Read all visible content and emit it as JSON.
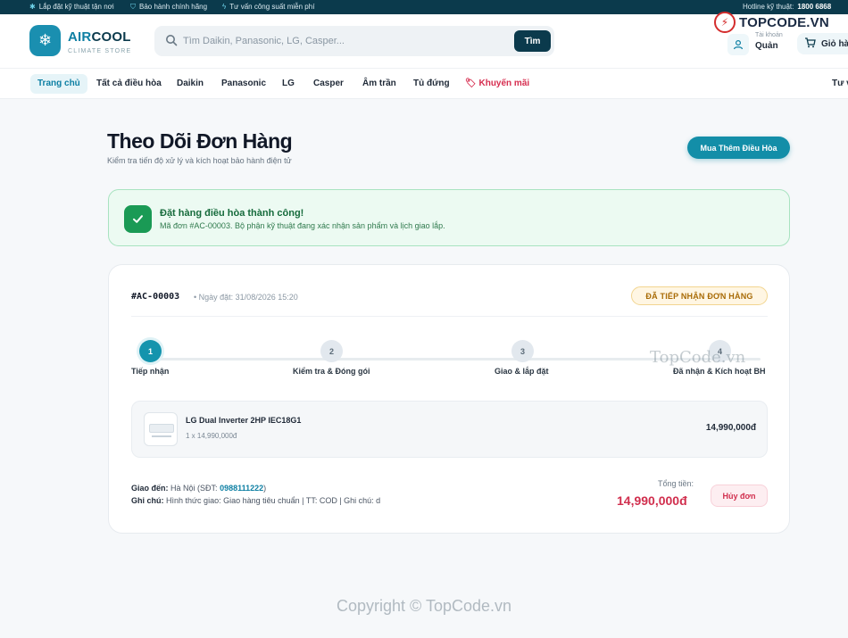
{
  "topbar": {
    "items": [
      {
        "icon": "wrench-icon",
        "text": "Lắp đặt kỹ thuật tận nơi"
      },
      {
        "icon": "shield-icon",
        "text": "Bảo hành chính hãng"
      },
      {
        "icon": "bolt-icon",
        "text": "Tư vấn công suất miễn phí"
      }
    ],
    "hotline_label": "Hotline kỹ thuật:",
    "hotline_number": "1800 6868"
  },
  "brand": {
    "name_part1": "AIR",
    "name_part2": "COOL",
    "tagline": "CLIMATE STORE",
    "logo_icon": "snowflake-icon"
  },
  "search": {
    "placeholder": "Tìm Daikin, Panasonic, LG, Casper...",
    "value": "",
    "button_label": "Tìm"
  },
  "partner_badge": {
    "text": "TOPCODE.VN"
  },
  "account": {
    "caption": "Tài khoản",
    "name": "Quản"
  },
  "cart": {
    "label": "Giỏ hàng"
  },
  "nav": {
    "items": [
      {
        "label": "Trang chủ",
        "active": true
      },
      {
        "label": "Tất cả điều hòa"
      },
      {
        "label": "Daikin"
      },
      {
        "label": "Panasonic"
      },
      {
        "label": "LG"
      },
      {
        "label": "Casper"
      },
      {
        "label": "Âm trần"
      },
      {
        "label": "Tủ đứng"
      },
      {
        "label": "Khuyến mãi",
        "icon": "tag-icon"
      }
    ],
    "right_label": "Tư vấn"
  },
  "page": {
    "title": "Theo Dõi Đơn Hàng",
    "subtitle": "Kiểm tra tiến độ xử lý và kích hoạt bảo hành điện tử",
    "buy_more_label": "Mua Thêm Điều Hòa"
  },
  "alert": {
    "title": "Đặt hàng điều hòa thành công!",
    "message": "Mã đơn #AC-00003. Bộ phận kỹ thuật đang xác nhận sản phẩm và lịch giao lắp.",
    "color": "#1a9a55"
  },
  "order": {
    "id": "#AC-00003",
    "date": "• Ngày đặt: 31/08/2026 15:20",
    "status": "ĐÃ TIẾP NHẬN ĐƠN HÀNG",
    "steps": [
      {
        "number": "1",
        "label": "Tiếp nhận",
        "done": true
      },
      {
        "number": "2",
        "label": "Kiểm tra & Đóng gói",
        "done": false
      },
      {
        "number": "3",
        "label": "Giao & lắp đặt",
        "done": false
      },
      {
        "number": "4",
        "label": "Đã nhận & Kích hoạt BH",
        "done": false
      }
    ],
    "item": {
      "name": "LG Dual Inverter 2HP IEC18G1",
      "qty": "1 x 14,990,000đ",
      "price": "14,990,000đ"
    },
    "ship_label": "Giao đến:",
    "ship_address": "Hà Nội (SĐT:",
    "ship_phone": "0988111222",
    "ship_close": ")",
    "note_label": "Ghi chú:",
    "note_text": "Hình thức giao: Giao hàng tiêu chuẩn | TT: COD | Ghi chú: d",
    "total_label": "Tổng tiền:",
    "total_value": "14,990,000đ",
    "cancel_label": "Hủy đơn"
  },
  "watermarks": {
    "mid": "TopCode.vn",
    "footer": "Copyright © TopCode.vn"
  },
  "colors": {
    "accent": "#138ea8",
    "dark": "#0b3a4c",
    "danger": "#d12f4e",
    "success": "#1a9a55",
    "warning": "#a86b06"
  }
}
